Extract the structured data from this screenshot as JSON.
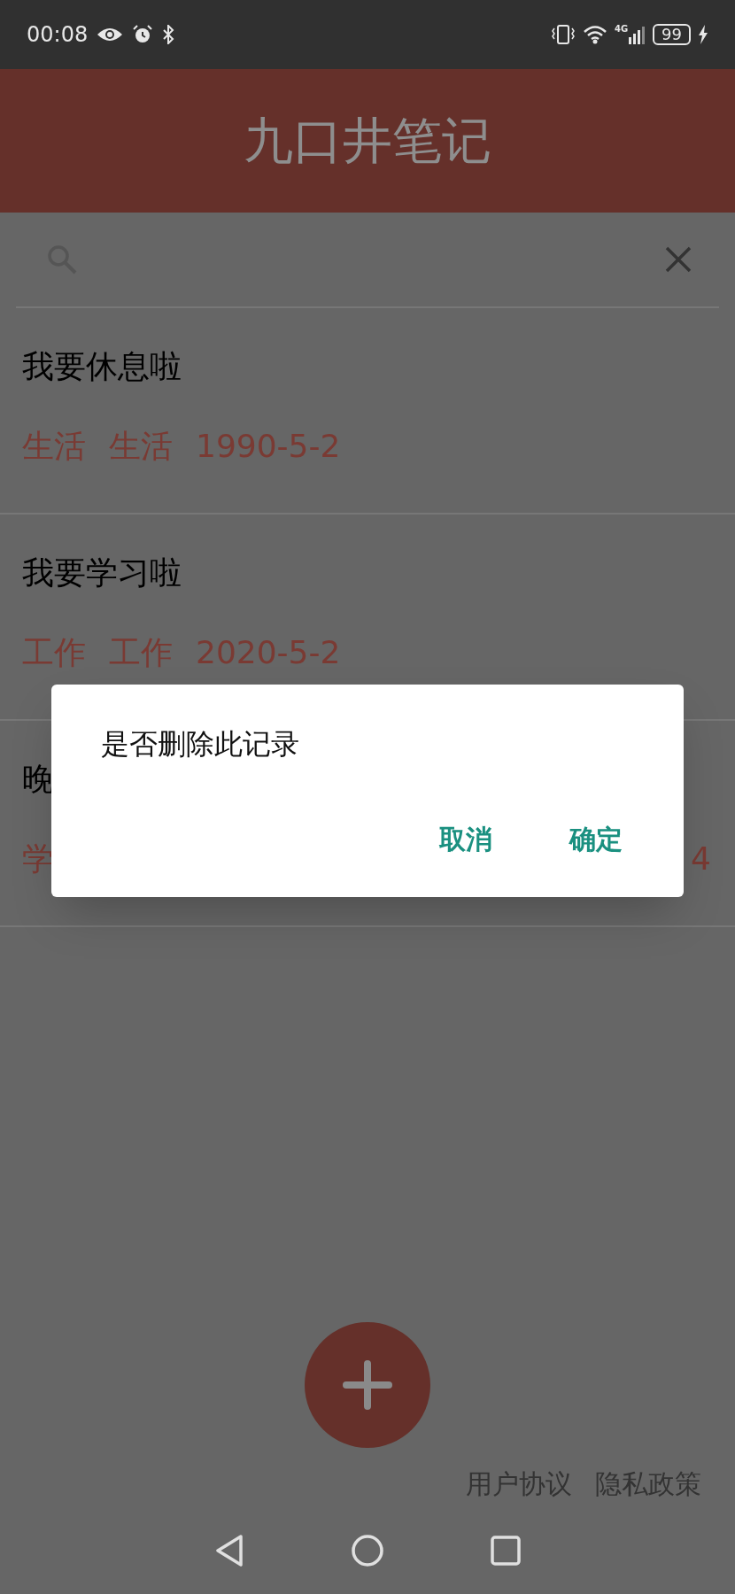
{
  "status_bar": {
    "time": "00:08",
    "network": "4G",
    "battery": "99"
  },
  "app_bar": {
    "title": "九口井笔记"
  },
  "notes": [
    {
      "kind": "full",
      "title": "我要休息啦",
      "category": "生活",
      "tag": "生活",
      "date": "1990-5-2"
    },
    {
      "kind": "full",
      "title": "我要学习啦",
      "category": "工作",
      "tag": "工作",
      "date": "2020-5-2"
    },
    {
      "kind": "partial",
      "title": "晚",
      "meta_start": "学",
      "meta_end": "4"
    }
  ],
  "dialog": {
    "message": "是否删除此记录",
    "buttons": [
      "取消",
      "确定"
    ]
  },
  "footer_links": [
    "用户协议",
    "隐私政策"
  ]
}
